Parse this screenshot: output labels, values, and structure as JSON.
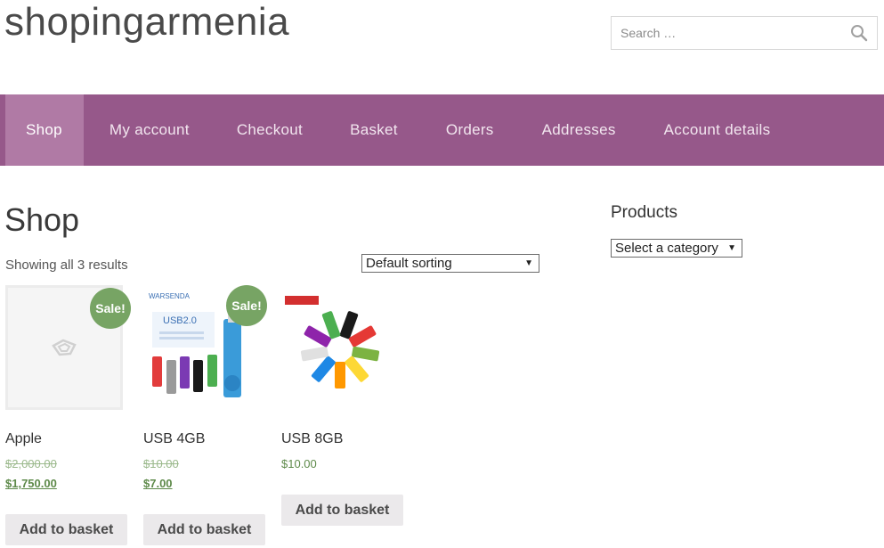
{
  "site": {
    "title": "shopingarmenia"
  },
  "search": {
    "placeholder": "Search …"
  },
  "nav": {
    "items": [
      {
        "label": "Shop"
      },
      {
        "label": "My account"
      },
      {
        "label": "Checkout"
      },
      {
        "label": "Basket"
      },
      {
        "label": "Orders"
      },
      {
        "label": "Addresses"
      },
      {
        "label": "Account details"
      }
    ],
    "active": "Shop"
  },
  "main": {
    "title": "Shop",
    "result_count": "Showing all 3 results",
    "sorting": {
      "selected": "Default sorting"
    }
  },
  "products": [
    {
      "name": "Apple",
      "sale_badge": "Sale!",
      "old_price": "$2,000.00",
      "new_price": "$1,750.00",
      "button": "Add to basket"
    },
    {
      "name": "USB 4GB",
      "sale_badge": "Sale!",
      "old_price": "$10.00",
      "new_price": "$7.00",
      "button": "Add to basket"
    },
    {
      "name": "USB 8GB",
      "price": "$10.00",
      "button": "Add to basket"
    }
  ],
  "sidebar": {
    "widget_title": "Products",
    "category_select": {
      "selected": "Select a category"
    }
  },
  "colors": {
    "nav_bg": "#96588a",
    "nav_active": "#b07aa5",
    "sale_badge": "#77a464",
    "price": "#5e8a4a"
  }
}
